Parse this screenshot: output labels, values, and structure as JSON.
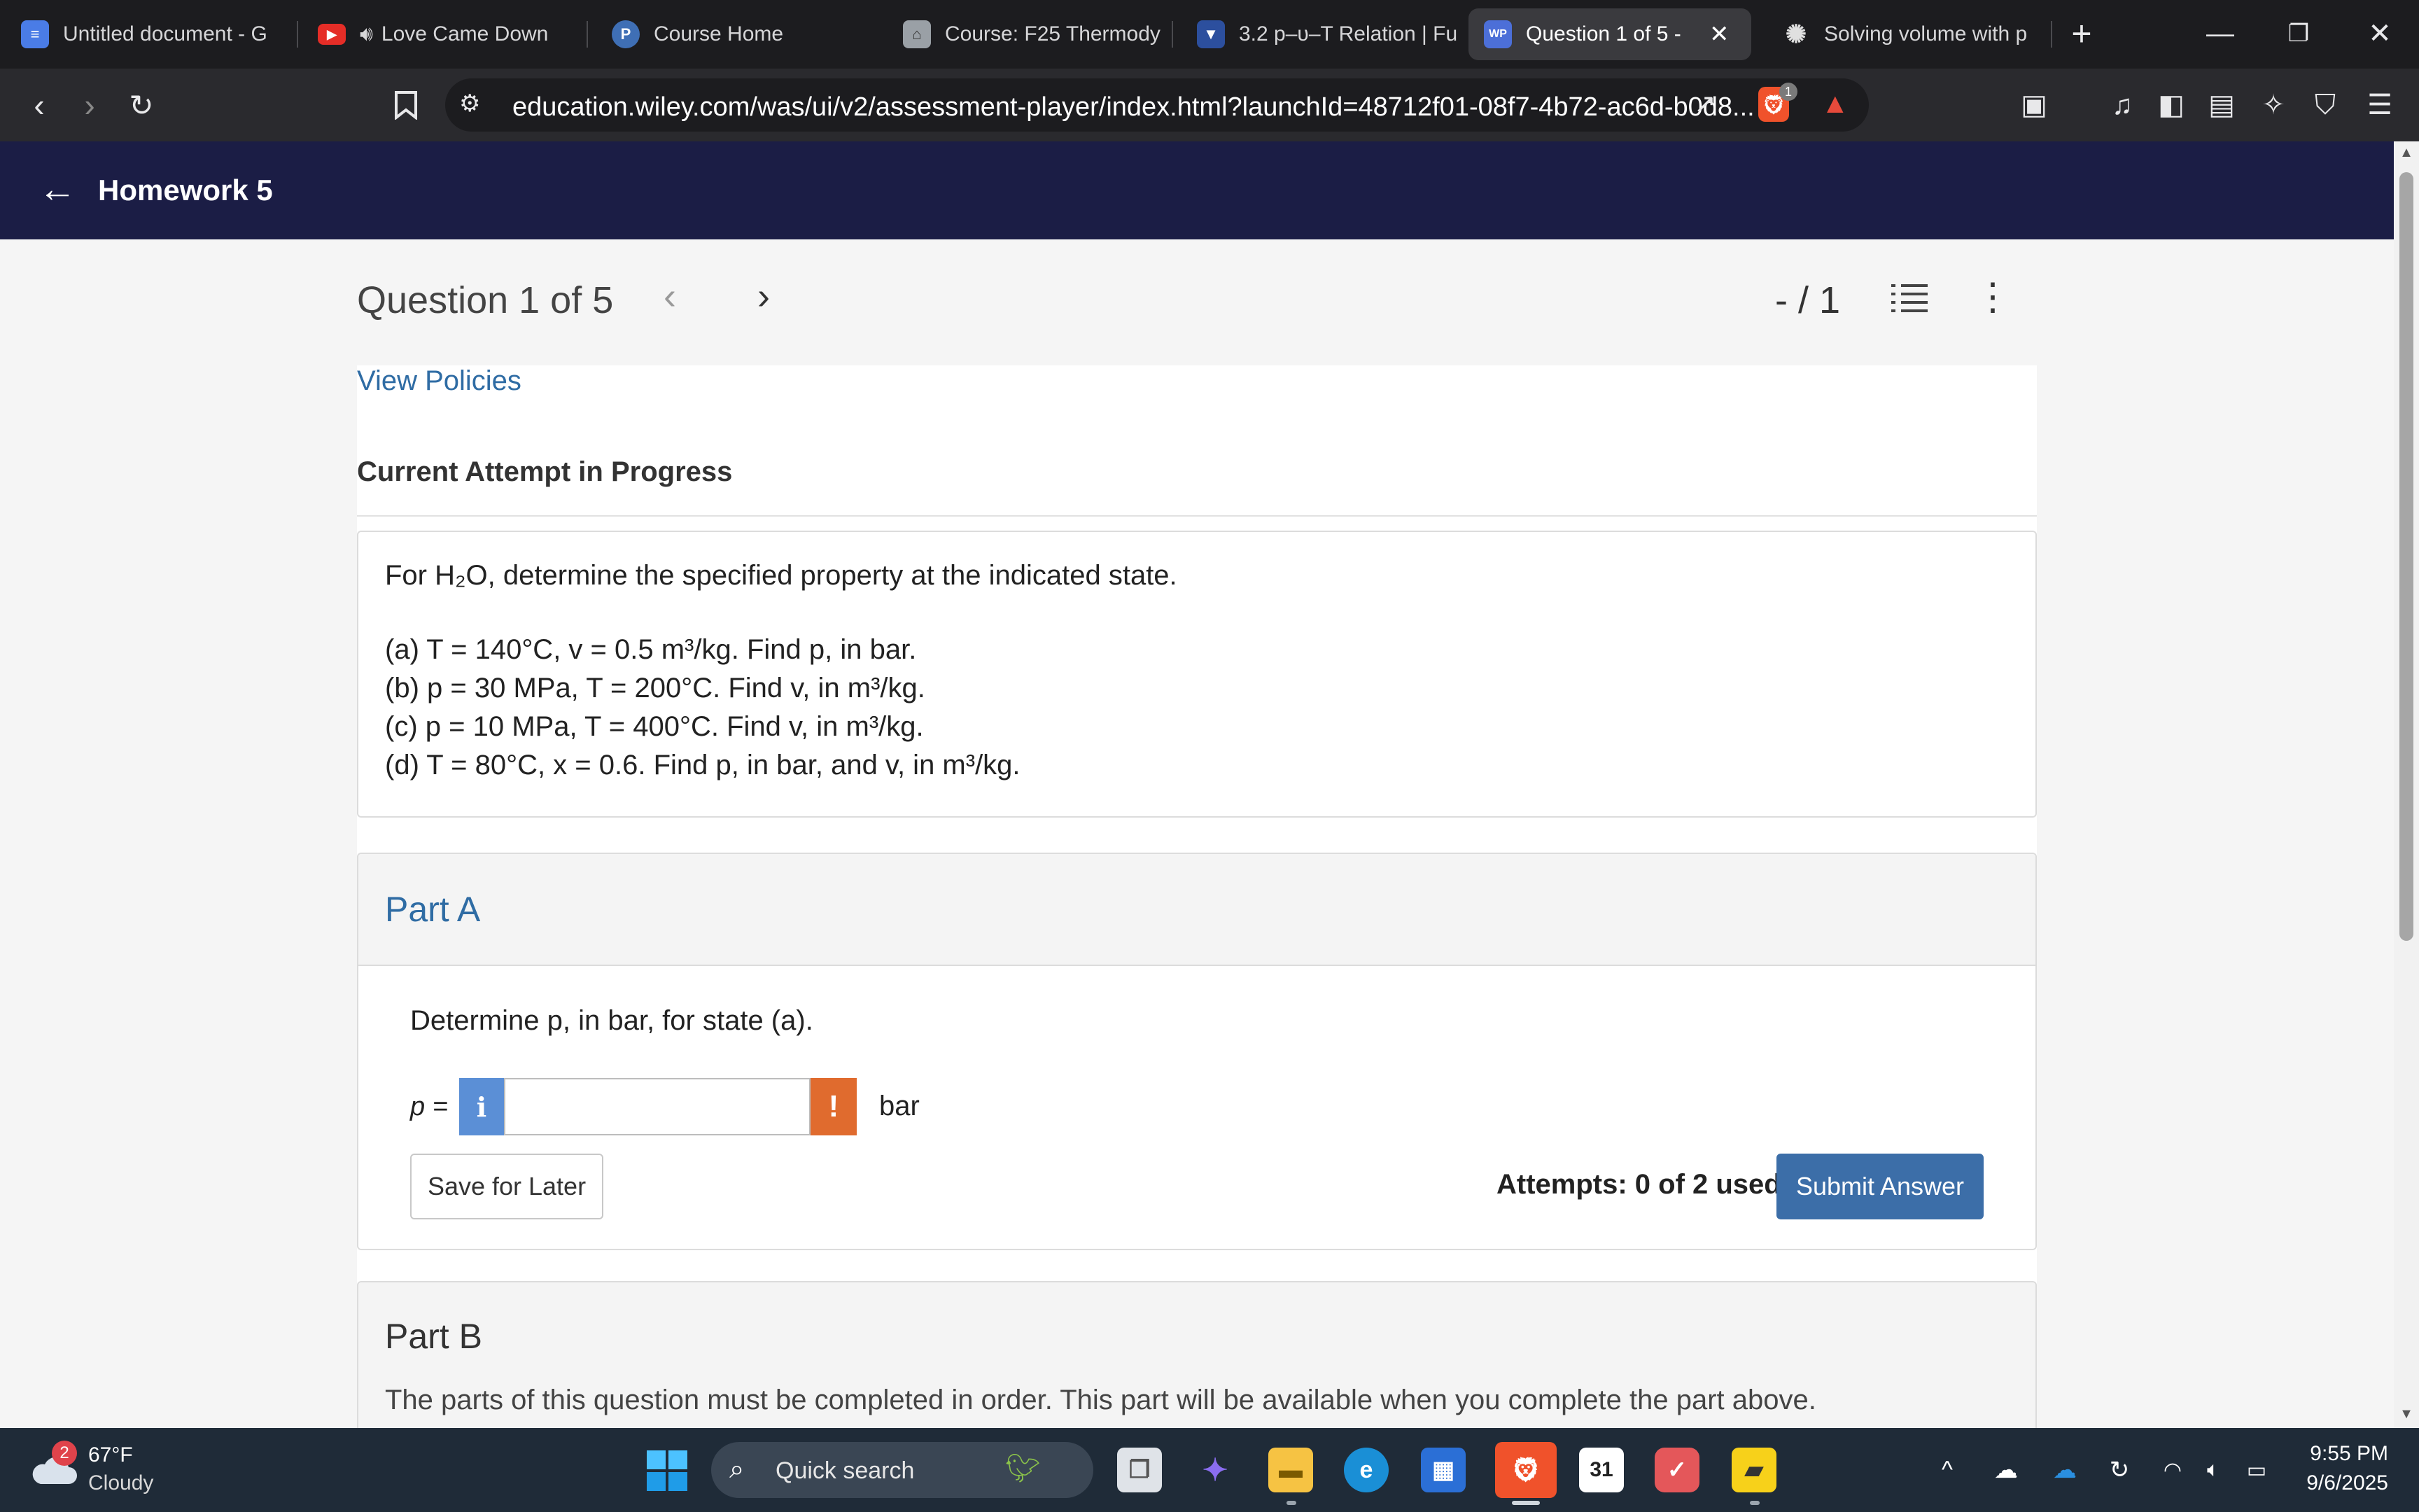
{
  "browser": {
    "tabs": [
      {
        "label": "Untitled document - G",
        "icon": "docs-icon",
        "color": "#4a7ce6"
      },
      {
        "label": "Love Came Down",
        "icon": "youtube-icon",
        "color": "#e52d27"
      },
      {
        "label": "Course Home",
        "icon": "pearson-icon",
        "color": "#3f6fb5"
      },
      {
        "label": "Course: F25 Thermody",
        "icon": "course-icon",
        "color": "#9aa0a6"
      },
      {
        "label": "3.2 p–υ–T Relation | Fu",
        "icon": "bookmark-icon",
        "color": "#2c4f9e"
      },
      {
        "label": "Question 1 of 5 -",
        "icon": "wileyplus-icon",
        "color": "#4c6fd8"
      },
      {
        "label": "Solving volume with p",
        "icon": "chatgpt-icon",
        "color": "#e0e0e0"
      }
    ],
    "url": "education.wiley.com/was/ui/v2/assessment-player/index.html?launchId=48712f01-08f7-4b72-ac6d-b0d8...",
    "brave_badge": "1"
  },
  "header": {
    "title": "Homework 5"
  },
  "question": {
    "title": "Question 1 of 5",
    "score": "- / 1",
    "view_policies": "View Policies",
    "attempt_heading": "Current Attempt in Progress",
    "intro": "For H₂O, determine the specified property at the indicated state.",
    "states": [
      "(a) T = 140°C, v = 0.5 m³/kg. Find p, in bar.",
      "(b) p = 30 MPa, T = 200°C. Find v, in m³/kg.",
      "(c) p = 10 MPa, T = 400°C. Find v, in m³/kg.",
      "(d) T = 80°C, x = 0.6. Find p, in bar, and v, in m³/kg."
    ]
  },
  "partA": {
    "title": "Part A",
    "prompt": "Determine p, in bar, for state (a).",
    "var_label": "p =",
    "info_icon": "i",
    "warn_icon": "!",
    "input_value": "",
    "unit": "bar",
    "save_label": "Save for Later",
    "attempts": "Attempts: 0 of 2 used",
    "submit_label": "Submit Answer"
  },
  "partB": {
    "title": "Part B",
    "note": "The parts of this question must be completed in order. This part will be available when you complete the part above."
  },
  "taskbar": {
    "weather_badge": "2",
    "temperature": "67°F",
    "condition": "Cloudy",
    "search_placeholder": "Quick search",
    "calendar_day": "31",
    "time": "9:55 PM",
    "date": "9/6/2025"
  },
  "colors": {
    "header_bg": "#1b1d45",
    "link": "#2f6ca4",
    "submit": "#3c6ea8",
    "warn": "#e06b2e",
    "info": "#5b8fd6"
  }
}
